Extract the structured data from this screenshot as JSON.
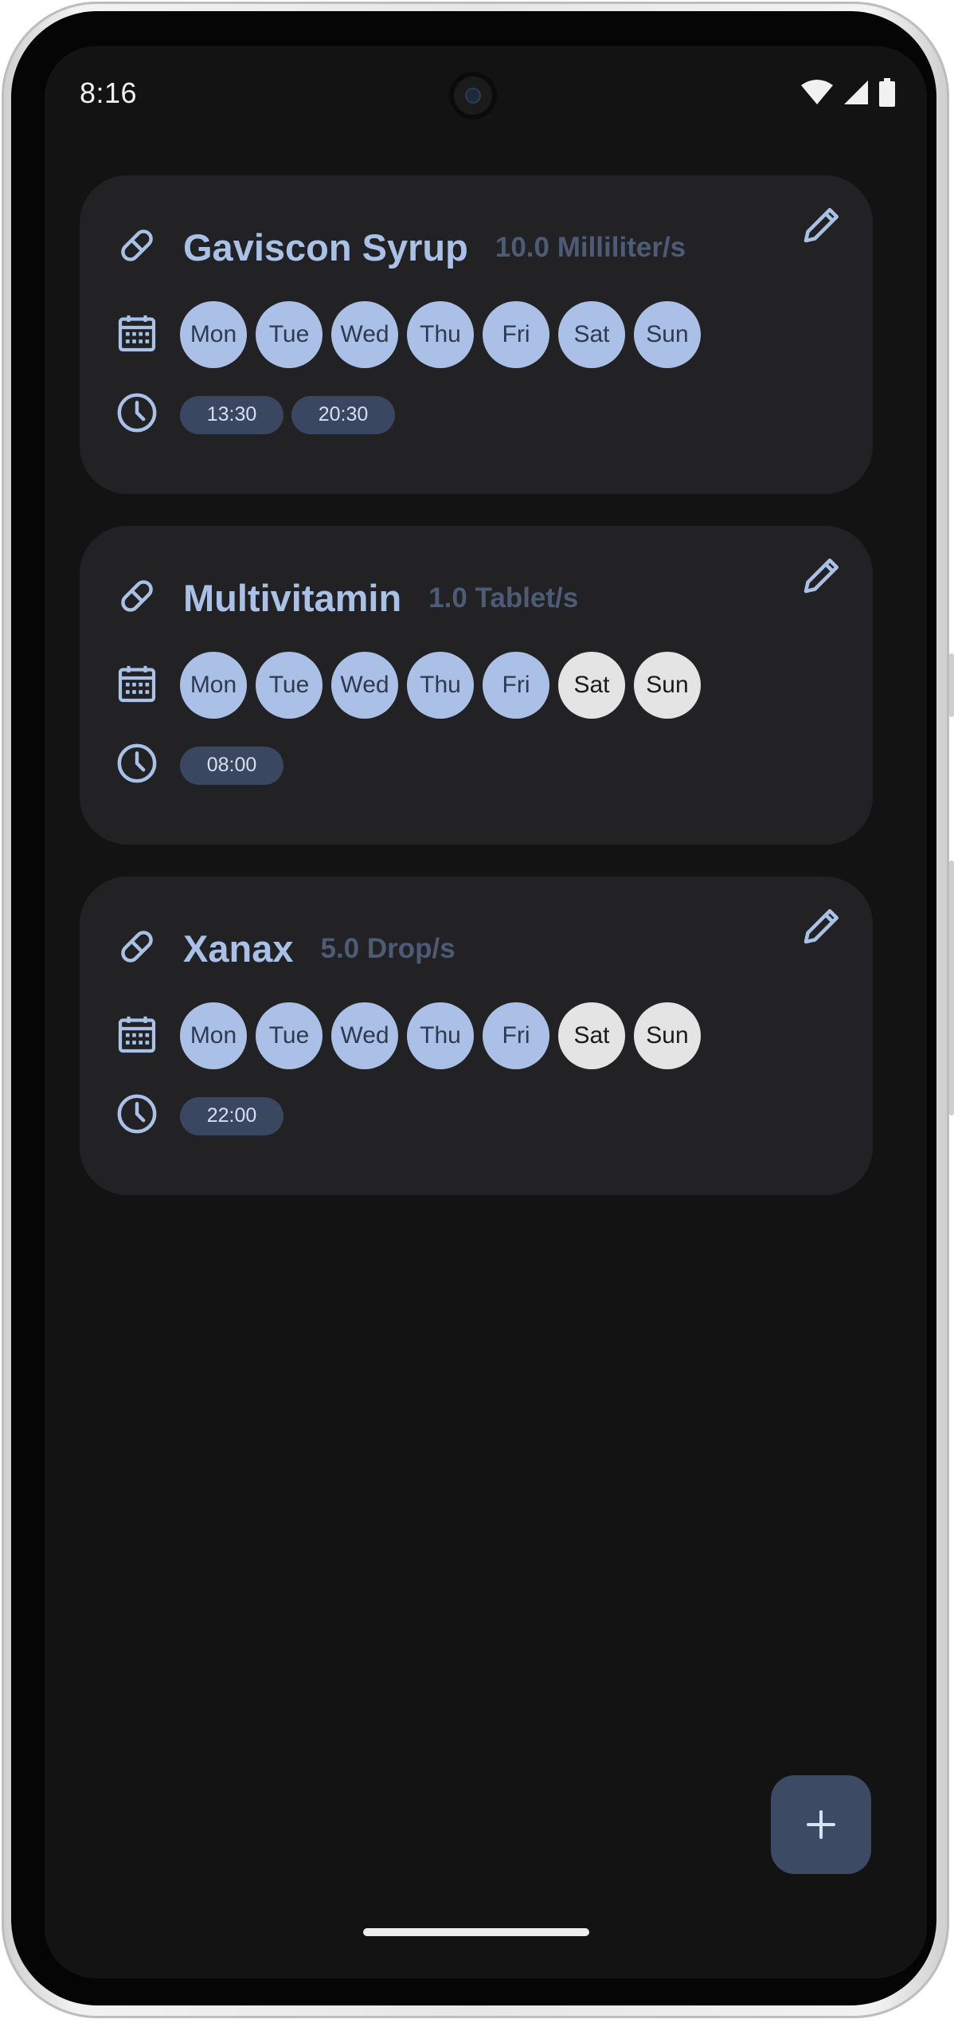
{
  "status_bar": {
    "time": "8:16"
  },
  "colors": {
    "accent": "#abc0e6",
    "card": "#222224",
    "background": "#131314",
    "day_off": "#e4e4e4",
    "chip": "#3a4760"
  },
  "medications": [
    {
      "name": "Gaviscon Syrup",
      "dosage": "10.0 Milliliter/s",
      "days": [
        {
          "label": "Mon",
          "active": true
        },
        {
          "label": "Tue",
          "active": true
        },
        {
          "label": "Wed",
          "active": true
        },
        {
          "label": "Thu",
          "active": true
        },
        {
          "label": "Fri",
          "active": true
        },
        {
          "label": "Sat",
          "active": true
        },
        {
          "label": "Sun",
          "active": true
        }
      ],
      "times": [
        "13:30",
        "20:30"
      ]
    },
    {
      "name": "Multivitamin",
      "dosage": "1.0 Tablet/s",
      "days": [
        {
          "label": "Mon",
          "active": true
        },
        {
          "label": "Tue",
          "active": true
        },
        {
          "label": "Wed",
          "active": true
        },
        {
          "label": "Thu",
          "active": true
        },
        {
          "label": "Fri",
          "active": true
        },
        {
          "label": "Sat",
          "active": false
        },
        {
          "label": "Sun",
          "active": false
        }
      ],
      "times": [
        "08:00"
      ]
    },
    {
      "name": "Xanax",
      "dosage": "5.0 Drop/s",
      "days": [
        {
          "label": "Mon",
          "active": true
        },
        {
          "label": "Tue",
          "active": true
        },
        {
          "label": "Wed",
          "active": true
        },
        {
          "label": "Thu",
          "active": true
        },
        {
          "label": "Fri",
          "active": true
        },
        {
          "label": "Sat",
          "active": false
        },
        {
          "label": "Sun",
          "active": false
        }
      ],
      "times": [
        "22:00"
      ]
    }
  ],
  "icons": {
    "medication": "pill-icon",
    "schedule": "calendar-icon",
    "time": "clock-icon",
    "edit": "pencil-icon",
    "add": "plus-icon"
  }
}
